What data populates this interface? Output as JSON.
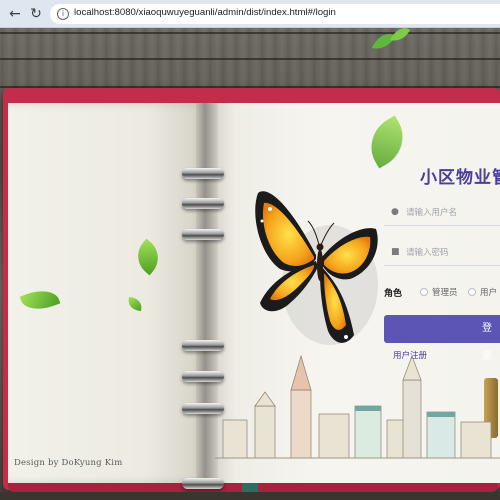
{
  "browser": {
    "url": "localhost:8080/xiaoquwuyeguanli/admin/dist/index.html#/login"
  },
  "notebook": {
    "credit": "Design by DoKyung Kim"
  },
  "login": {
    "title": "小区物业管",
    "username_placeholder": "请输入用户名",
    "password_placeholder": "请输入密码",
    "role_label": "角色",
    "roles": [
      "管理员",
      "用户"
    ],
    "submit_label": "登录",
    "register_link": "用户注册"
  },
  "colors": {
    "accent": "#5b55b5",
    "title": "#4a3f9b",
    "notebook_cover": "#c42c4c"
  },
  "icons": {
    "back": "back-arrow-icon",
    "reload": "reload-icon",
    "site_info": "info-icon",
    "username": "user-icon",
    "password": "lock-icon"
  }
}
